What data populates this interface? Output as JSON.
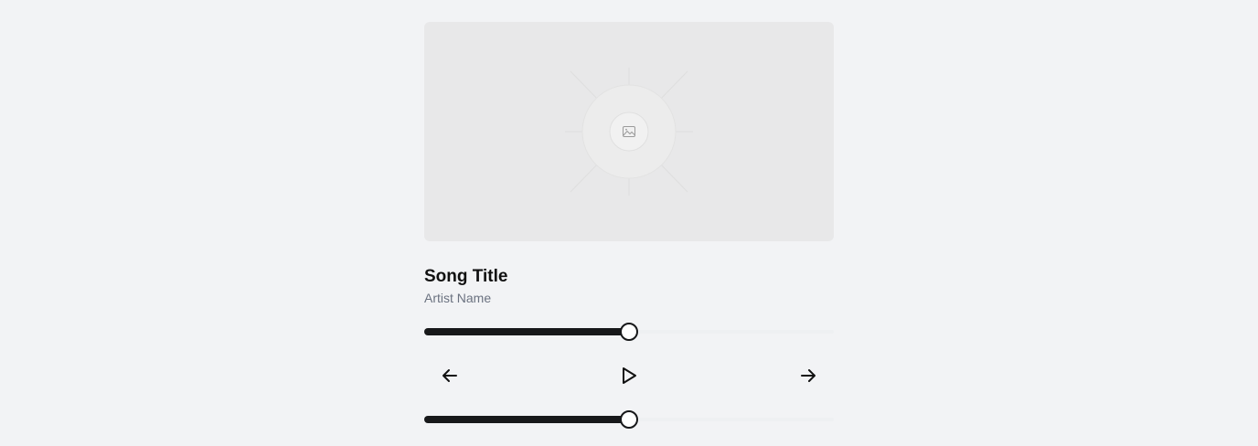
{
  "artwork": {
    "icon": "image-placeholder-icon"
  },
  "song": {
    "title": "Song Title",
    "artist": "Artist Name"
  },
  "progress": {
    "value": 0.5
  },
  "controls": {
    "previous_icon": "arrow-left-icon",
    "play_icon": "play-icon",
    "next_icon": "arrow-right-icon"
  },
  "volume": {
    "value": 0.5
  },
  "colors": {
    "background": "#f2f3f5",
    "artwork_bg": "#e8e8e9",
    "slider_fill": "#17181a",
    "title": "#111111",
    "artist": "#6b7280"
  }
}
